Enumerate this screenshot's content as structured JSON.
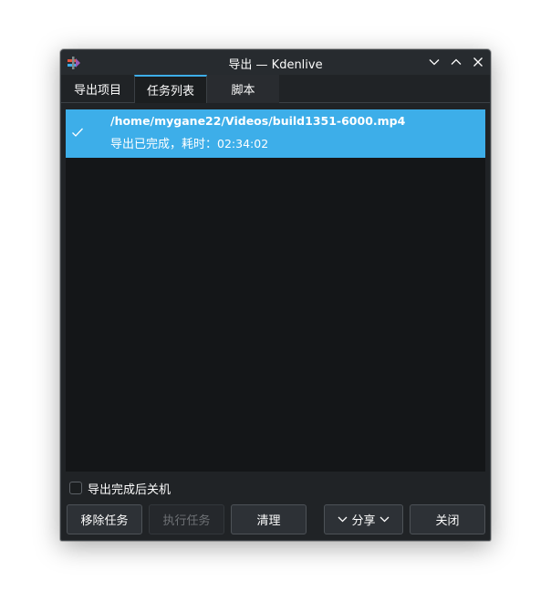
{
  "window": {
    "title_main": "导出",
    "title_sep": " — ",
    "title_app": "Kdenlive",
    "controls": [
      "minimize",
      "maximize",
      "close"
    ]
  },
  "tabs": [
    {
      "label": "导出项目",
      "active": false
    },
    {
      "label": "任务列表",
      "active": true
    },
    {
      "label": "脚本",
      "active": false
    }
  ],
  "jobs": [
    {
      "file": "/home/mygane22/Videos/build1351-6000.mp4",
      "status_prefix": "导出已完成，耗时：",
      "duration": "02:34:02",
      "done": true
    }
  ],
  "shutdown_option": {
    "label": "导出完成后关机",
    "checked": false
  },
  "buttons": {
    "remove": "移除任务",
    "start": "执行任务",
    "clean": "清理",
    "share": "分享",
    "close": "关闭"
  },
  "colors": {
    "accent": "#3daee9",
    "window_bg": "#202326",
    "list_bg": "#141618"
  }
}
